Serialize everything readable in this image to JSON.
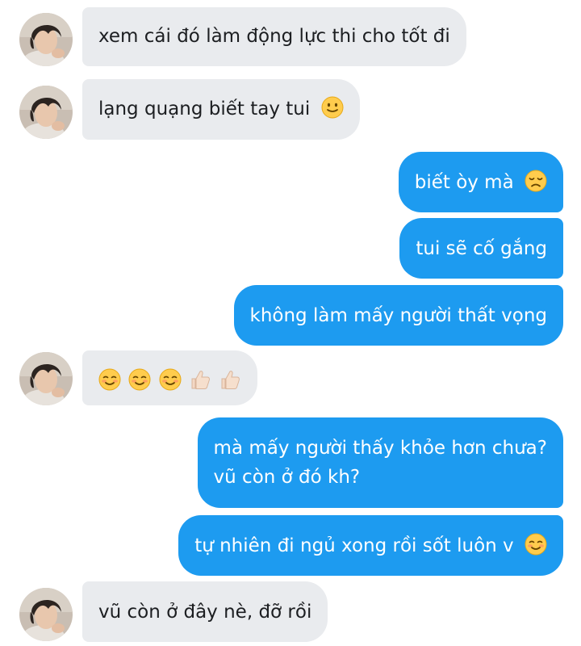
{
  "conversation": {
    "messages": [
      {
        "sender": "contact",
        "text": "xem cái đó làm động lực thi cho tốt đi"
      },
      {
        "sender": "contact",
        "text": "lạng quạng biết tay tui",
        "emoji": "slightly-smiling-face"
      },
      {
        "sender": "me",
        "text": "biết òy mà",
        "emoji": "disappointed-face"
      },
      {
        "sender": "me",
        "text": "tui sẽ cố gắng"
      },
      {
        "sender": "me",
        "text": "không làm mấy người thất vọng"
      },
      {
        "sender": "contact",
        "emojis": [
          "smiling-face",
          "smiling-face",
          "smiling-face",
          "thumbs-up-light-skin",
          "thumbs-up-light-skin"
        ]
      },
      {
        "sender": "me",
        "text_line1": "mà mấy người thấy khỏe hơn chưa?",
        "text_line2": "vũ còn ở đó kh?"
      },
      {
        "sender": "me",
        "text": "tự nhiên đi ngủ xong rồi sốt luôn v",
        "emoji": "smiling-face"
      },
      {
        "sender": "contact",
        "text": "vũ còn ở đây nè, đỡ rồi"
      }
    ]
  },
  "colors": {
    "incoming_bubble": "#e9ebee",
    "outgoing_bubble": "#1d9bf0",
    "incoming_text": "#1c1e21",
    "outgoing_text": "#ffffff"
  }
}
